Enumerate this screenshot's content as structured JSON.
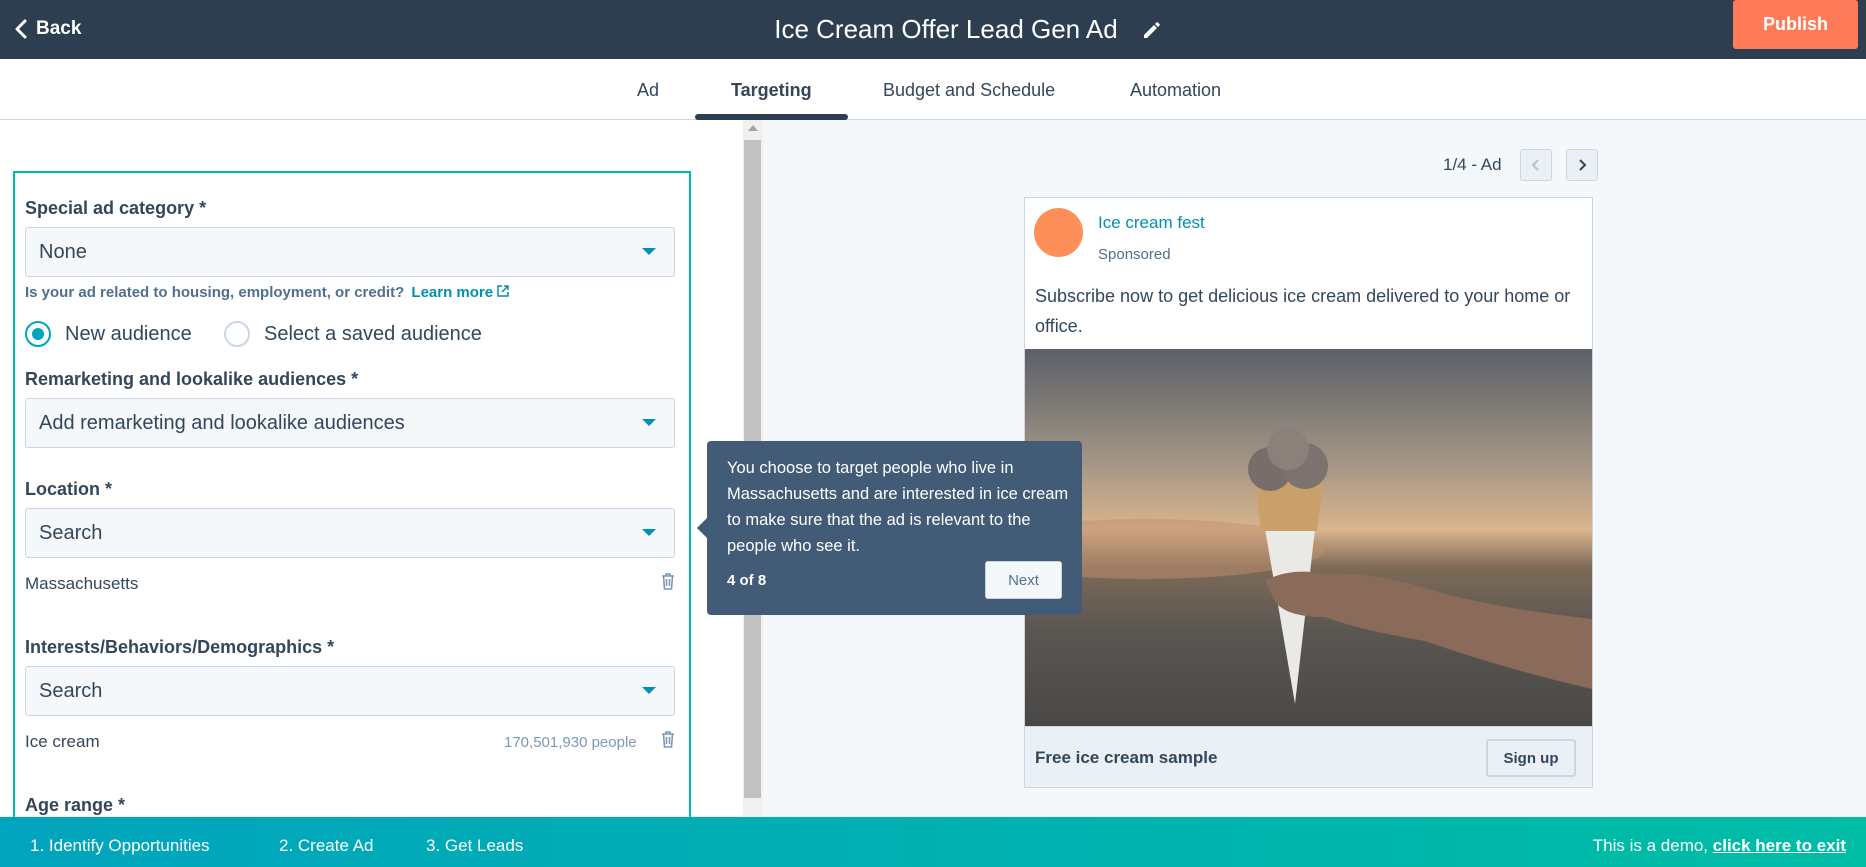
{
  "header": {
    "back_label": "Back",
    "title": "Ice Cream Offer Lead Gen Ad",
    "publish_label": "Publish"
  },
  "tabs": [
    {
      "label": "Ad"
    },
    {
      "label": "Targeting"
    },
    {
      "label": "Budget and Schedule"
    },
    {
      "label": "Automation"
    }
  ],
  "active_tab": "Targeting",
  "form": {
    "special_ad_category": {
      "label": "Special ad category *",
      "value": "None",
      "helper": "Is your ad related to housing, employment, or credit?",
      "helper_link": "Learn more"
    },
    "audience_options": [
      {
        "label": "New audience",
        "selected": true
      },
      {
        "label": "Select a saved audience",
        "selected": false
      }
    ],
    "remarketing": {
      "label": "Remarketing and lookalike audiences *",
      "placeholder": "Add remarketing and lookalike audiences"
    },
    "location": {
      "label": "Location *",
      "placeholder": "Search",
      "selected_item": "Massachusetts"
    },
    "interests": {
      "label": "Interests/Behaviors/Demographics *",
      "placeholder": "Search",
      "selected_item": "Ice cream",
      "selected_count": "170,501,930 people"
    },
    "age_range": {
      "label": "Age range *"
    }
  },
  "preview": {
    "pager": "1/4 - Ad",
    "page_name": "Ice cream fest",
    "sponsored": "Sponsored",
    "body": "Subscribe now to get delicious ice cream delivered to your home or office.",
    "footer_title": "Free ice cream sample",
    "cta_label": "Sign up"
  },
  "tooltip": {
    "text": "You choose to target people who live in Massachusetts and are interested in ice cream to make sure that the ad is relevant to the people who see it.",
    "step": "4 of 8",
    "next_label": "Next"
  },
  "bottom_bar": {
    "steps": [
      {
        "label": "1. Identify Opportunities"
      },
      {
        "label": "2. Create Ad"
      },
      {
        "label": "3. Get Leads"
      }
    ],
    "demo_text": "This is a demo,",
    "exit_link": "click here to exit"
  },
  "colors": {
    "header_bg": "#2d3e50",
    "publish": "#ff7a59",
    "accent": "#00bda5",
    "link": "#0091ae",
    "tooltip_bg": "#425b76"
  }
}
